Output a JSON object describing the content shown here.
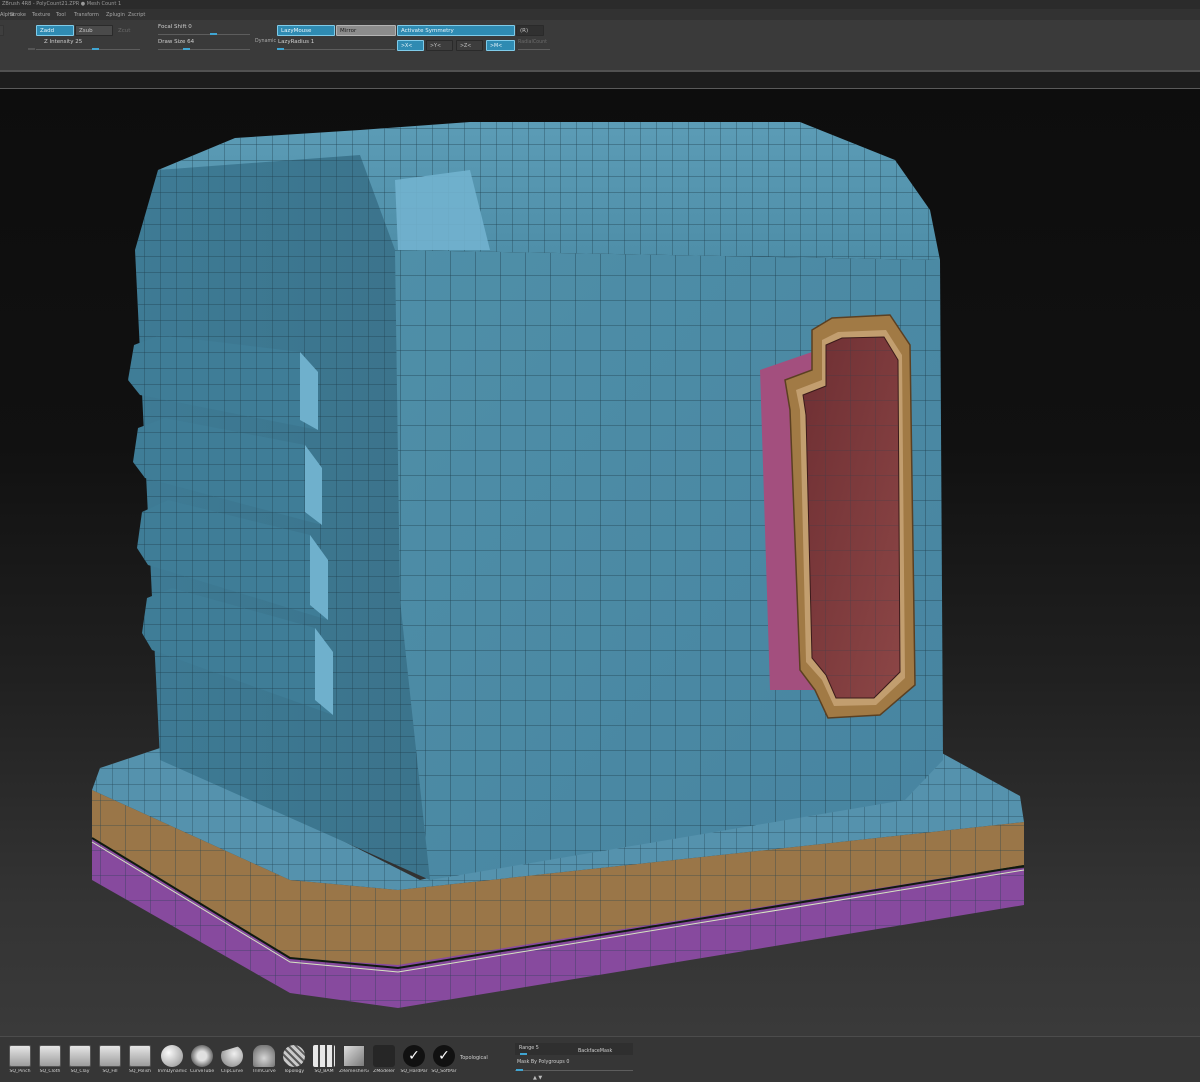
{
  "window": {
    "title": "ZBrush 4R8 - PolyCount21.ZPR  ● Mesh Count 1"
  },
  "menubar": {
    "items": [
      "Alpha",
      "Stroke",
      "Texture",
      "Tool",
      "Transform",
      "Zplugin",
      "Zscript"
    ]
  },
  "toolbar": {
    "zadd": "Zadd",
    "zsub": "Zsub",
    "zcut": "Zcut",
    "z_intensity": "Z Intensity 25",
    "focal_shift": "Focal Shift 0",
    "draw_size": "Draw Size 64",
    "dynamic": "Dynamic",
    "lazymouse": "LazyMouse",
    "lazyradius": "LazyRadius 1",
    "mirror": "Mirror",
    "activate_symmetry": "Activate Symmetry",
    "symmetry_key": "(R)",
    "axis_x": ">X<",
    "axis_y": ">Y<",
    "axis_z": ">Z<",
    "axis_m": ">M<",
    "radial_count": "RadialCount"
  },
  "shelf": {
    "tools": [
      "SQ_Pinch",
      "SQ_Cloth",
      "SQ_Clay",
      "SQ_Fill",
      "SQ_Polish",
      "TrimDynamic",
      "CurveTube",
      "ClipCurve",
      "TrimCurve",
      "Topology",
      "SQ_BAM",
      "ZRemesherG",
      "ZModeler",
      "SQ_HardPar",
      "SQ_SoftPar"
    ],
    "topological": "Topological",
    "range": "Range 5",
    "backface_mask": "BackfaceMask",
    "mask_by_polygroups": "Mask By Polygroups 0"
  },
  "colors": {
    "mesh_blue": "#4a8aa3",
    "mesh_blue_light": "#72b3cf",
    "trim_gold": "#a17a45",
    "base_purple": "#8f4fa8",
    "door_red": "#7d3b3b",
    "accent_button": "#2f8bb2"
  }
}
